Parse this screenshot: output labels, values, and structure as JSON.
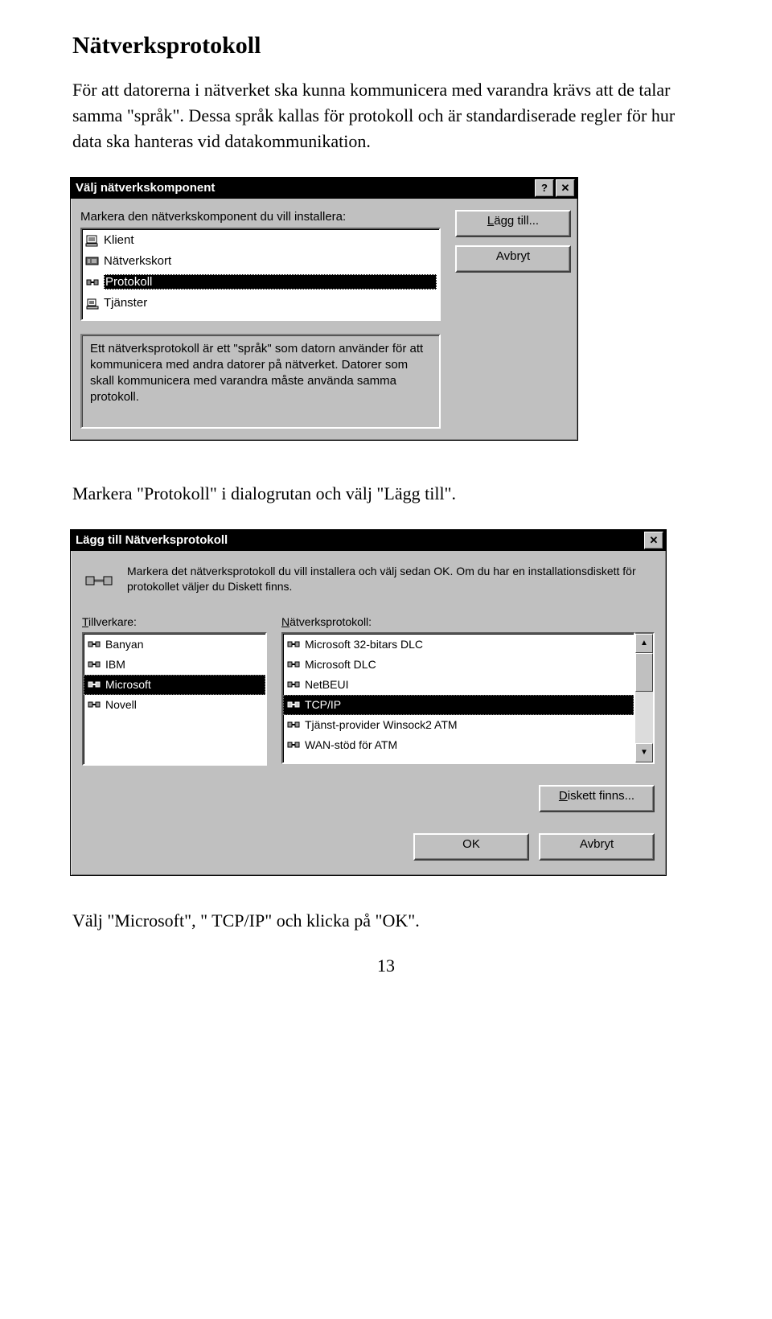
{
  "heading": "Nätverksprotokoll",
  "intro": "För att datorerna i nätverket ska kunna kommunicera med varandra krävs att de talar samma \"språk\". Dessa språk kallas för protokoll och är standardiserade regler för hur data ska hanteras vid datakommunikation.",
  "mid_text": "Markera \"Protokoll\" i dialogrutan och välj \"Lägg till\".",
  "end_text": "Välj \"Microsoft\", \" TCP/IP\" och klicka på \"OK\".",
  "page_number": "13",
  "dlg1": {
    "title": "Välj nätverkskomponent",
    "help_btn": "?",
    "close_btn": "✕",
    "instruction": "Markera den nätverkskomponent du vill installera:",
    "items": [
      "Klient",
      "Nätverkskort",
      "Protokoll",
      "Tjänster"
    ],
    "selected_index": 2,
    "add_btn": "Lägg till...",
    "cancel_btn": "Avbryt",
    "description": "Ett nätverksprotokoll är ett \"språk\" som datorn använder för att kommunicera med andra datorer på nätverket. Datorer som skall kommunicera med varandra måste använda samma protokoll."
  },
  "dlg2": {
    "title": "Lägg till Nätverksprotokoll",
    "close_btn": "✕",
    "instruction": "Markera det nätverksprotokoll du vill installera och välj sedan OK. Om du har en installationsdiskett för protokollet väljer du Diskett finns.",
    "manuf_label_pre": "T",
    "manuf_label_rest": "illverkare:",
    "proto_label_pre": "N",
    "proto_label_rest": "ätverksprotokoll:",
    "manufacturers": [
      "Banyan",
      "IBM",
      "Microsoft",
      "Novell"
    ],
    "manuf_selected": 2,
    "protocols": [
      "Microsoft 32-bitars DLC",
      "Microsoft DLC",
      "NetBEUI",
      "TCP/IP",
      "Tjänst-provider Winsock2 ATM",
      "WAN-stöd för ATM"
    ],
    "proto_selected": 3,
    "disk_btn": "Diskett finns...",
    "ok_btn": "OK",
    "cancel_btn": "Avbryt"
  }
}
